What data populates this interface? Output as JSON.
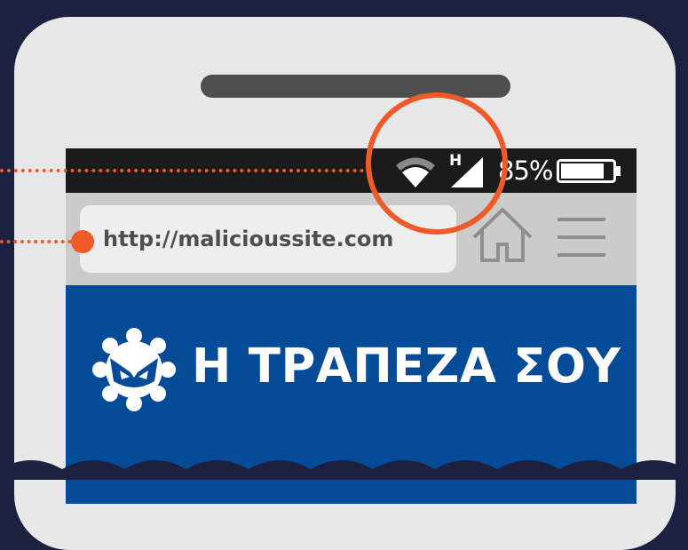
{
  "status_bar": {
    "network_type": "H",
    "battery_percent": "85%",
    "battery_level": 0.85,
    "icons": [
      "wifi-icon",
      "cell-signal-icon",
      "battery-icon"
    ]
  },
  "browser": {
    "url": "http://malicioussite.com",
    "icons": [
      "home-icon",
      "hamburger-menu-icon"
    ]
  },
  "page": {
    "bank_title": "Η ΤΡΑΠΕΖΑ ΣΟΥ",
    "logo_icon": "malicious-gear-mask-icon"
  },
  "colors": {
    "background": "#1c2142",
    "phone_body": "#e8e8e9",
    "status_bar": "#1b1b1b",
    "browser_bar": "#cbcbcb",
    "bank_blue": "#054b98",
    "highlight": "#ee5a28"
  }
}
